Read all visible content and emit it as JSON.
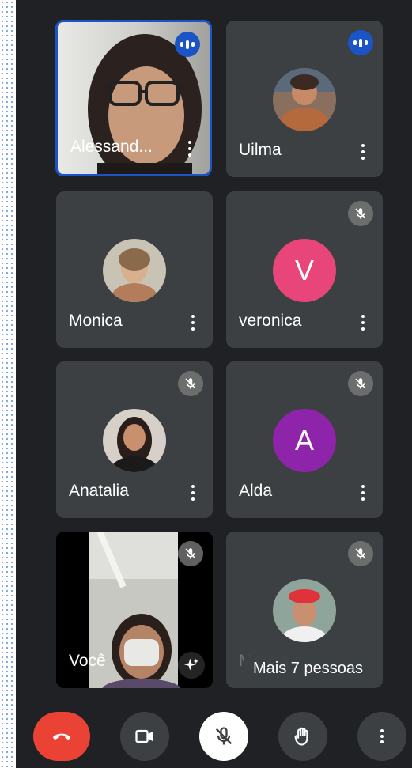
{
  "participants": [
    {
      "name": "Alessand...",
      "status": "speaking"
    },
    {
      "name": "Uilma",
      "status": "speaking"
    },
    {
      "name": "Monica",
      "status": "none"
    },
    {
      "name": "veronica",
      "status": "muted",
      "initial": "V"
    },
    {
      "name": "Anatalia",
      "status": "muted"
    },
    {
      "name": "Alda",
      "status": "muted",
      "initial": "A"
    },
    {
      "name": "Você",
      "status": "muted"
    },
    {
      "name": "Marcia",
      "status": "muted"
    }
  ],
  "more_people_label": "Mais 7 pessoas",
  "colors": {
    "background": "#202124",
    "tile": "#3c4043",
    "active_border": "#1a54c6",
    "end_call": "#ea4335",
    "avatar_v": "#e8457a",
    "avatar_a": "#8e24aa"
  },
  "controls": {
    "end_call": "phone-hangup-icon",
    "camera": "video-camera-icon",
    "microphone": "mic-off-icon",
    "raise_hand": "hand-icon",
    "more": "more-vertical-icon"
  }
}
